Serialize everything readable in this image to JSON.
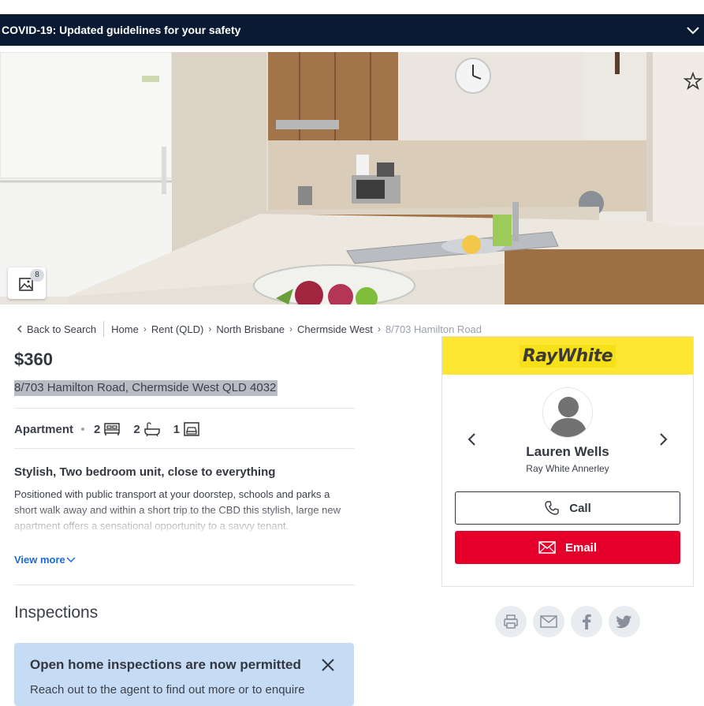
{
  "covid_banner": {
    "text": "COVID-19: Updated guidelines for your safety"
  },
  "gallery": {
    "photo_count": "8"
  },
  "breadcrumb": {
    "back": "Back to Search",
    "items": [
      "Home",
      "Rent (QLD)",
      "North Brisbane",
      "Chermside West"
    ],
    "current": "8/703 Hamilton Road"
  },
  "listing": {
    "price": "$360",
    "address": "8/703 Hamilton Road, Chermside West QLD 4032",
    "property_type": "Apartment",
    "bedrooms": "2",
    "bathrooms": "2",
    "parking": "1",
    "headline": "Stylish, Two bedroom unit, close to everything",
    "description": "Positioned with public transport at your doorstep, schools and parks a short walk away and within a short trip to the CBD this stylish, large new apartment offers a sensational opportunity to a savvy tenant.",
    "view_more": "View more"
  },
  "inspections": {
    "title": "Inspections",
    "notice_title": "Open home inspections are now permitted",
    "notice_body": "Reach out to the agent to find out more or to enquire"
  },
  "agent": {
    "brand": "RayWhite",
    "brand_color": "#ffe632",
    "name": "Lauren Wells",
    "agency": "Ray White Annerley",
    "call_label": "Call",
    "email_label": "Email",
    "email_color": "#e4002b"
  },
  "share": {
    "icons": [
      "print-icon",
      "mail-icon",
      "facebook-icon",
      "twitter-icon"
    ]
  }
}
